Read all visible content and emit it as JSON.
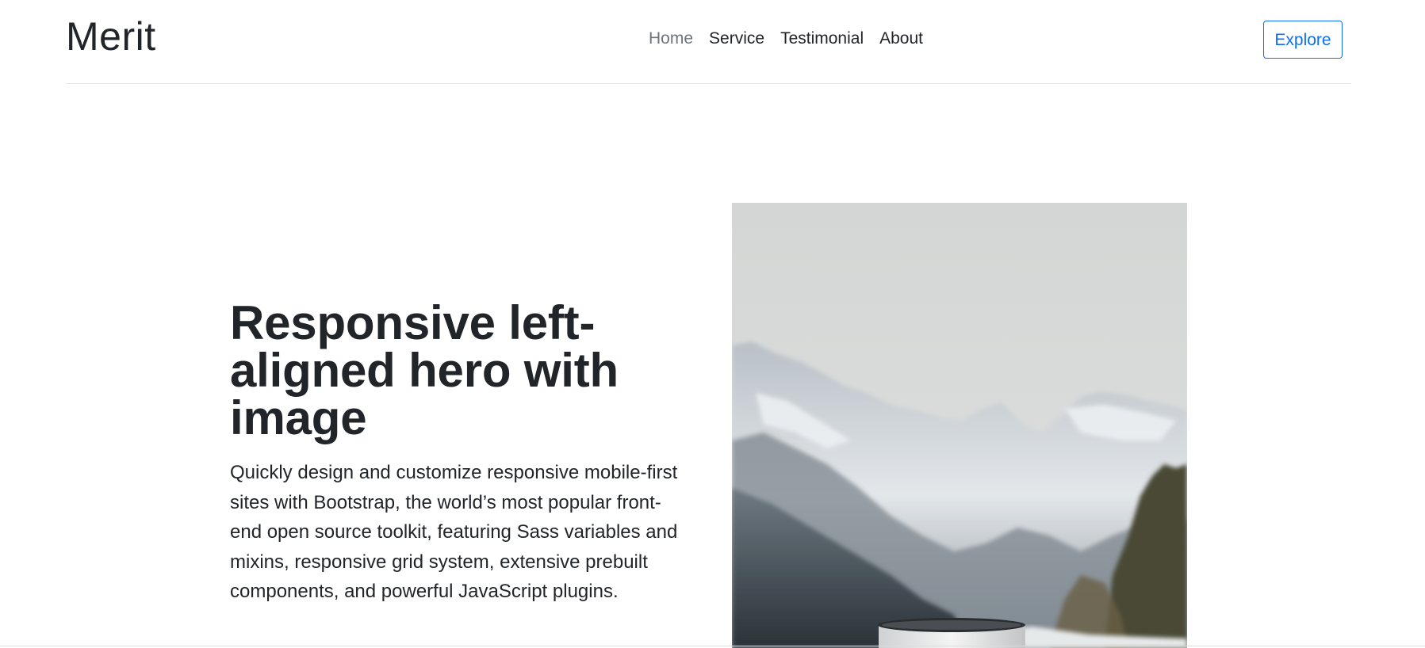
{
  "header": {
    "brand": "Merit",
    "nav": [
      {
        "label": "Home",
        "active": true
      },
      {
        "label": "Service",
        "active": false
      },
      {
        "label": "Testimonial",
        "active": false
      },
      {
        "label": "About",
        "active": false
      }
    ],
    "cta_label": "Explore"
  },
  "hero": {
    "title": "Responsive left-aligned hero with image",
    "lead": "Quickly design and customize responsive mobile-first sites with Bootstrap, the world’s most popular front-end open source toolkit, featuring Sass variables and mixins, responsive grid system, extensive prebuilt components, and powerful JavaScript plugins.",
    "image_subject": "snowy mountains with enamel mug"
  },
  "colors": {
    "text": "#212529",
    "muted": "#6c757d",
    "primary": "#0d6efd",
    "border": "#e4e6e8"
  }
}
